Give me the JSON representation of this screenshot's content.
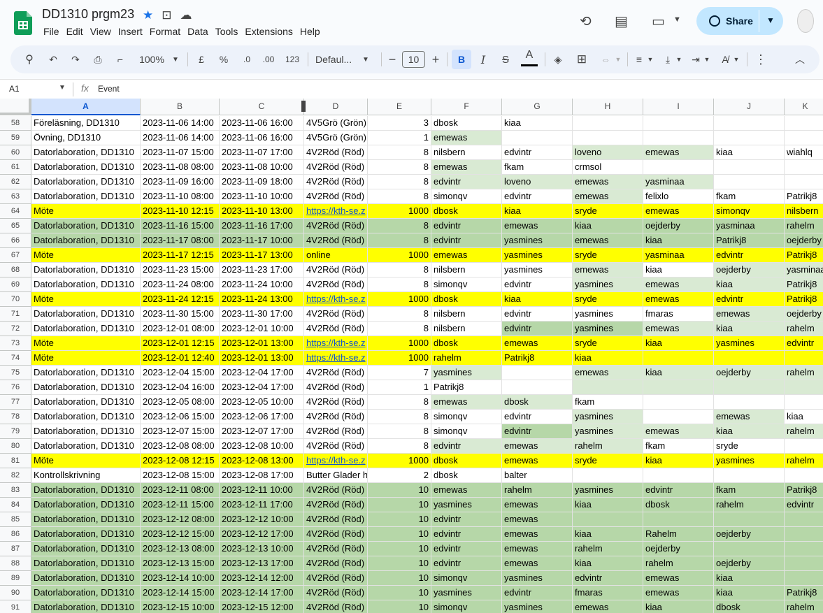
{
  "doc": {
    "title": "DD1310 prgm23",
    "menu": [
      "File",
      "Edit",
      "View",
      "Insert",
      "Format",
      "Data",
      "Tools",
      "Extensions",
      "Help"
    ],
    "share_label": "Share"
  },
  "toolbar": {
    "zoom": "100%",
    "currency": "£",
    "percent": "%",
    "dec_less": ".0",
    "dec_more": ".00",
    "format_123": "123",
    "font": "Defaul...",
    "font_size": "10",
    "bold": "B",
    "italic": "I",
    "strike": "S",
    "text_color": "A"
  },
  "formula_bar": {
    "cell_ref": "A1",
    "fx": "fx",
    "content": "Event"
  },
  "colors": {
    "yellow": "#ffff00",
    "light_green": "#d9ead3",
    "green": "#b6d7a8",
    "white": "#ffffff"
  },
  "columns": [
    "A",
    "B",
    "C",
    "D",
    "E",
    "F",
    "G",
    "H",
    "I",
    "J",
    "K"
  ],
  "rows": [
    {
      "n": "58",
      "cells": [
        "Föreläsning, DD1310",
        "2023-11-06 14:00",
        "2023-11-06 16:00",
        "4V5Grö (Grön)",
        "3",
        "dbosk",
        "kiaa",
        "",
        "",
        "",
        ""
      ],
      "fill": [
        "",
        "",
        "",
        "",
        "",
        "",
        "",
        "",
        "",
        "",
        ""
      ]
    },
    {
      "n": "59",
      "cells": [
        "Övning, DD1310",
        "2023-11-06 14:00",
        "2023-11-06 16:00",
        "4V5Grö (Grön)",
        "1",
        "emewas",
        "",
        "",
        "",
        "",
        ""
      ],
      "fill": [
        "",
        "",
        "",
        "",
        "",
        "lg",
        "",
        "",
        "",
        "",
        ""
      ]
    },
    {
      "n": "60",
      "cells": [
        "Datorlaboration, DD1310",
        "2023-11-07 15:00",
        "2023-11-07 17:00",
        "4V2Röd (Röd)",
        "8",
        "nilsbern",
        "edvintr",
        "loveno",
        "emewas",
        "kiaa",
        "wiahlq"
      ],
      "fill": [
        "",
        "",
        "",
        "",
        "",
        "",
        "",
        "lg",
        "lg",
        "",
        ""
      ]
    },
    {
      "n": "61",
      "cells": [
        "Datorlaboration, DD1310",
        "2023-11-08 08:00",
        "2023-11-08 10:00",
        "4V2Röd (Röd)",
        "8",
        "emewas",
        "fkam",
        "crmsol",
        "",
        "",
        ""
      ],
      "fill": [
        "",
        "",
        "",
        "",
        "",
        "lg",
        "",
        "",
        "",
        "",
        ""
      ]
    },
    {
      "n": "62",
      "cells": [
        "Datorlaboration, DD1310",
        "2023-11-09 16:00",
        "2023-11-09 18:00",
        "4V2Röd (Röd)",
        "8",
        "edvintr",
        "loveno",
        "emewas",
        "yasminaa",
        "",
        ""
      ],
      "fill": [
        "",
        "",
        "",
        "",
        "",
        "lg",
        "lg",
        "lg",
        "lg",
        "",
        ""
      ]
    },
    {
      "n": "63",
      "cells": [
        "Datorlaboration, DD1310",
        "2023-11-10 08:00",
        "2023-11-10 10:00",
        "4V2Röd (Röd)",
        "8",
        "simonqv",
        "edvintr",
        "emewas",
        "felixlo",
        "fkam",
        "Patrikj8"
      ],
      "fill": [
        "",
        "",
        "",
        "",
        "",
        "",
        "",
        "lg",
        "",
        "",
        ""
      ]
    },
    {
      "n": "64",
      "cells": [
        "Möte",
        "2023-11-10 12:15",
        "2023-11-10 13:00",
        "https://kth-se.z",
        "1000",
        "dbosk",
        "kiaa",
        "sryde",
        "emewas",
        "simonqv",
        "nilsbern"
      ],
      "fill": [
        "y",
        "y",
        "y",
        "y",
        "y",
        "y",
        "y",
        "y",
        "y",
        "y",
        "y"
      ],
      "link": true
    },
    {
      "n": "65",
      "cells": [
        "Datorlaboration, DD1310",
        "2023-11-16 15:00",
        "2023-11-16 17:00",
        "4V2Röd (Röd)",
        "8",
        "edvintr",
        "emewas",
        "kiaa",
        "oejderby",
        "yasminaa",
        "rahelm"
      ],
      "fill": [
        "g",
        "g",
        "g",
        "g",
        "g",
        "g",
        "g",
        "g",
        "g",
        "g",
        "g"
      ]
    },
    {
      "n": "66",
      "cells": [
        "Datorlaboration, DD1310",
        "2023-11-17 08:00",
        "2023-11-17 10:00",
        "4V2Röd (Röd)",
        "8",
        "edvintr",
        "yasmines",
        "emewas",
        "kiaa",
        "Patrikj8",
        "oejderby"
      ],
      "fill": [
        "g",
        "g",
        "g",
        "g",
        "g",
        "g",
        "g",
        "g",
        "g",
        "g",
        "g"
      ]
    },
    {
      "n": "67",
      "cells": [
        "Möte",
        "2023-11-17 12:15",
        "2023-11-17 13:00",
        "online",
        "1000",
        "emewas",
        "yasmines",
        "sryde",
        "yasminaa",
        "edvintr",
        "Patrikj8"
      ],
      "fill": [
        "y",
        "y",
        "y",
        "y",
        "y",
        "y",
        "y",
        "y",
        "y",
        "y",
        "y"
      ]
    },
    {
      "n": "68",
      "cells": [
        "Datorlaboration, DD1310",
        "2023-11-23 15:00",
        "2023-11-23 17:00",
        "4V2Röd (Röd)",
        "8",
        "nilsbern",
        "yasmines",
        "emewas",
        "kiaa",
        "oejderby",
        "yasminaa"
      ],
      "fill": [
        "",
        "",
        "",
        "",
        "",
        "",
        "",
        "lg",
        "",
        "lg",
        "lg"
      ]
    },
    {
      "n": "69",
      "cells": [
        "Datorlaboration, DD1310",
        "2023-11-24 08:00",
        "2023-11-24 10:00",
        "4V2Röd (Röd)",
        "8",
        "simonqv",
        "edvintr",
        "yasmines",
        "emewas",
        "kiaa",
        "Patrikj8"
      ],
      "fill": [
        "",
        "",
        "",
        "",
        "",
        "",
        "",
        "lg",
        "lg",
        "lg",
        "lg"
      ]
    },
    {
      "n": "70",
      "cells": [
        "Möte",
        "2023-11-24 12:15",
        "2023-11-24 13:00",
        "https://kth-se.z",
        "1000",
        "dbosk",
        "kiaa",
        "sryde",
        "emewas",
        "edvintr",
        "Patrikj8"
      ],
      "fill": [
        "y",
        "y",
        "y",
        "y",
        "y",
        "y",
        "y",
        "y",
        "y",
        "y",
        "y"
      ],
      "link": true
    },
    {
      "n": "71",
      "cells": [
        "Datorlaboration, DD1310",
        "2023-11-30 15:00",
        "2023-11-30 17:00",
        "4V2Röd (Röd)",
        "8",
        "nilsbern",
        "edvintr",
        "yasmines",
        "fmaras",
        "emewas",
        "oejderby"
      ],
      "fill": [
        "",
        "",
        "",
        "",
        "",
        "",
        "",
        "",
        "",
        "lg",
        "lg"
      ]
    },
    {
      "n": "72",
      "cells": [
        "Datorlaboration, DD1310",
        "2023-12-01 08:00",
        "2023-12-01 10:00",
        "4V2Röd (Röd)",
        "8",
        "nilsbern",
        "edvintr",
        "yasmines",
        "emewas",
        "kiaa",
        "rahelm"
      ],
      "fill": [
        "",
        "",
        "",
        "",
        "",
        "",
        "g",
        "g",
        "lg",
        "lg",
        "lg"
      ]
    },
    {
      "n": "73",
      "cells": [
        "Möte",
        "2023-12-01 12:15",
        "2023-12-01 13:00",
        "https://kth-se.z",
        "1000",
        "dbosk",
        "emewas",
        "sryde",
        "kiaa",
        "yasmines",
        "edvintr"
      ],
      "fill": [
        "y",
        "y",
        "y",
        "y",
        "y",
        "y",
        "y",
        "y",
        "y",
        "y",
        "y"
      ],
      "link": true
    },
    {
      "n": "74",
      "cells": [
        "Möte",
        "2023-12-01 12:40",
        "2023-12-01 13:00",
        "https://kth-se.z",
        "1000",
        "rahelm",
        "Patrikj8",
        "kiaa",
        "",
        "",
        ""
      ],
      "fill": [
        "y",
        "y",
        "y",
        "y",
        "y",
        "y",
        "y",
        "y",
        "y",
        "y",
        "y"
      ],
      "link": true
    },
    {
      "n": "75",
      "cells": [
        "Datorlaboration, DD1310",
        "2023-12-04 15:00",
        "2023-12-04 17:00",
        "4V2Röd (Röd)",
        "7",
        "yasmines",
        "",
        "emewas",
        "kiaa",
        "oejderby",
        "rahelm"
      ],
      "fill": [
        "",
        "",
        "",
        "",
        "",
        "lg",
        "",
        "lg",
        "lg",
        "lg",
        "lg"
      ]
    },
    {
      "n": "76",
      "cells": [
        "Datorlaboration, DD1310",
        "2023-12-04 16:00",
        "2023-12-04 17:00",
        "4V2Röd (Röd)",
        "1",
        "Patrikj8",
        "",
        "",
        "",
        "",
        ""
      ],
      "fill": [
        "",
        "",
        "",
        "",
        "",
        "",
        "",
        "lg",
        "lg",
        "lg",
        "lg"
      ]
    },
    {
      "n": "77",
      "cells": [
        "Datorlaboration, DD1310",
        "2023-12-05 08:00",
        "2023-12-05 10:00",
        "4V2Röd (Röd)",
        "8",
        "emewas",
        "dbosk",
        "fkam",
        "",
        "",
        ""
      ],
      "fill": [
        "",
        "",
        "",
        "",
        "",
        "lg",
        "lg",
        "",
        "",
        "",
        ""
      ]
    },
    {
      "n": "78",
      "cells": [
        "Datorlaboration, DD1310",
        "2023-12-06 15:00",
        "2023-12-06 17:00",
        "4V2Röd (Röd)",
        "8",
        "simonqv",
        "edvintr",
        "yasmines",
        "",
        "emewas",
        "kiaa"
      ],
      "fill": [
        "",
        "",
        "",
        "",
        "",
        "",
        "",
        "lg",
        "",
        "lg",
        ""
      ]
    },
    {
      "n": "79",
      "cells": [
        "Datorlaboration, DD1310",
        "2023-12-07 15:00",
        "2023-12-07 17:00",
        "4V2Röd (Röd)",
        "8",
        "simonqv",
        "edvintr",
        "yasmines",
        "emewas",
        "kiaa",
        "rahelm"
      ],
      "fill": [
        "",
        "",
        "",
        "",
        "",
        "",
        "g",
        "lg",
        "lg",
        "lg",
        "lg"
      ]
    },
    {
      "n": "80",
      "cells": [
        "Datorlaboration, DD1310",
        "2023-12-08 08:00",
        "2023-12-08 10:00",
        "4V2Röd (Röd)",
        "8",
        "edvintr",
        "emewas",
        "rahelm",
        "fkam",
        "sryde",
        ""
      ],
      "fill": [
        "",
        "",
        "",
        "",
        "",
        "lg",
        "lg",
        "lg",
        "",
        "",
        ""
      ]
    },
    {
      "n": "81",
      "cells": [
        "Möte",
        "2023-12-08 12:15",
        "2023-12-08 13:00",
        "https://kth-se.z",
        "1000",
        "dbosk",
        "emewas",
        "sryde",
        "kiaa",
        "yasmines",
        "rahelm"
      ],
      "fill": [
        "y",
        "y",
        "y",
        "y",
        "y",
        "y",
        "y",
        "y",
        "y",
        "y",
        "y"
      ],
      "link": true
    },
    {
      "n": "82",
      "cells": [
        "Kontrollskrivning",
        "2023-12-08 15:00",
        "2023-12-08 17:00",
        "Butter Glader h",
        "2",
        "dbosk",
        "balter",
        "",
        "",
        "",
        ""
      ],
      "fill": [
        "",
        "",
        "",
        "",
        "",
        "",
        "",
        "",
        "",
        "",
        ""
      ]
    },
    {
      "n": "83",
      "cells": [
        "Datorlaboration, DD1310",
        "2023-12-11 08:00",
        "2023-12-11 10:00",
        "4V2Röd (Röd)",
        "10",
        "emewas",
        "rahelm",
        "yasmines",
        "edvintr",
        "fkam",
        "Patrikj8"
      ],
      "fill": [
        "g",
        "g",
        "g",
        "g",
        "g",
        "g",
        "g",
        "g",
        "g",
        "g",
        "g"
      ]
    },
    {
      "n": "84",
      "cells": [
        "Datorlaboration, DD1310",
        "2023-12-11 15:00",
        "2023-12-11 17:00",
        "4V2Röd (Röd)",
        "10",
        "yasmines",
        "emewas",
        "kiaa",
        "dbosk",
        "rahelm",
        "edvintr"
      ],
      "fill": [
        "g",
        "g",
        "g",
        "g",
        "g",
        "g",
        "g",
        "g",
        "g",
        "g",
        "g"
      ]
    },
    {
      "n": "85",
      "cells": [
        "Datorlaboration, DD1310",
        "2023-12-12 08:00",
        "2023-12-12 10:00",
        "4V2Röd (Röd)",
        "10",
        "edvintr",
        "emewas",
        "",
        "",
        "",
        ""
      ],
      "fill": [
        "g",
        "g",
        "g",
        "g",
        "g",
        "g",
        "g",
        "g",
        "g",
        "g",
        "g"
      ]
    },
    {
      "n": "86",
      "cells": [
        "Datorlaboration, DD1310",
        "2023-12-12 15:00",
        "2023-12-12 17:00",
        "4V2Röd (Röd)",
        "10",
        "edvintr",
        "emewas",
        "kiaa",
        "Rahelm",
        "oejderby",
        ""
      ],
      "fill": [
        "g",
        "g",
        "g",
        "g",
        "g",
        "g",
        "g",
        "g",
        "g",
        "g",
        "g"
      ]
    },
    {
      "n": "87",
      "cells": [
        "Datorlaboration, DD1310",
        "2023-12-13 08:00",
        "2023-12-13 10:00",
        "4V2Röd (Röd)",
        "10",
        "edvintr",
        "emewas",
        "rahelm",
        "oejderby",
        "",
        ""
      ],
      "fill": [
        "g",
        "g",
        "g",
        "g",
        "g",
        "g",
        "g",
        "g",
        "g",
        "g",
        "g"
      ]
    },
    {
      "n": "88",
      "cells": [
        "Datorlaboration, DD1310",
        "2023-12-13 15:00",
        "2023-12-13 17:00",
        "4V2Röd (Röd)",
        "10",
        "edvintr",
        "emewas",
        "kiaa",
        "rahelm",
        "oejderby",
        ""
      ],
      "fill": [
        "g",
        "g",
        "g",
        "g",
        "g",
        "g",
        "g",
        "g",
        "g",
        "g",
        "g"
      ]
    },
    {
      "n": "89",
      "cells": [
        "Datorlaboration, DD1310",
        "2023-12-14 10:00",
        "2023-12-14 12:00",
        "4V2Röd (Röd)",
        "10",
        "simonqv",
        "yasmines",
        "edvintr",
        "emewas",
        "kiaa",
        ""
      ],
      "fill": [
        "g",
        "g",
        "g",
        "g",
        "g",
        "g",
        "g",
        "g",
        "g",
        "g",
        "g"
      ]
    },
    {
      "n": "90",
      "cells": [
        "Datorlaboration, DD1310",
        "2023-12-14 15:00",
        "2023-12-14 17:00",
        "4V2Röd (Röd)",
        "10",
        "yasmines",
        "edvintr",
        "fmaras",
        "emewas",
        "kiaa",
        "Patrikj8"
      ],
      "fill": [
        "g",
        "g",
        "g",
        "g",
        "g",
        "g",
        "g",
        "g",
        "g",
        "g",
        "g"
      ]
    },
    {
      "n": "91",
      "cells": [
        "Datorlaboration, DD1310",
        "2023-12-15 10:00",
        "2023-12-15 12:00",
        "4V2Röd (Röd)",
        "10",
        "simonqv",
        "yasmines",
        "emewas",
        "kiaa",
        "dbosk",
        "rahelm"
      ],
      "fill": [
        "g",
        "g",
        "g",
        "g",
        "g",
        "g",
        "g",
        "g",
        "g",
        "g",
        "g"
      ]
    }
  ]
}
